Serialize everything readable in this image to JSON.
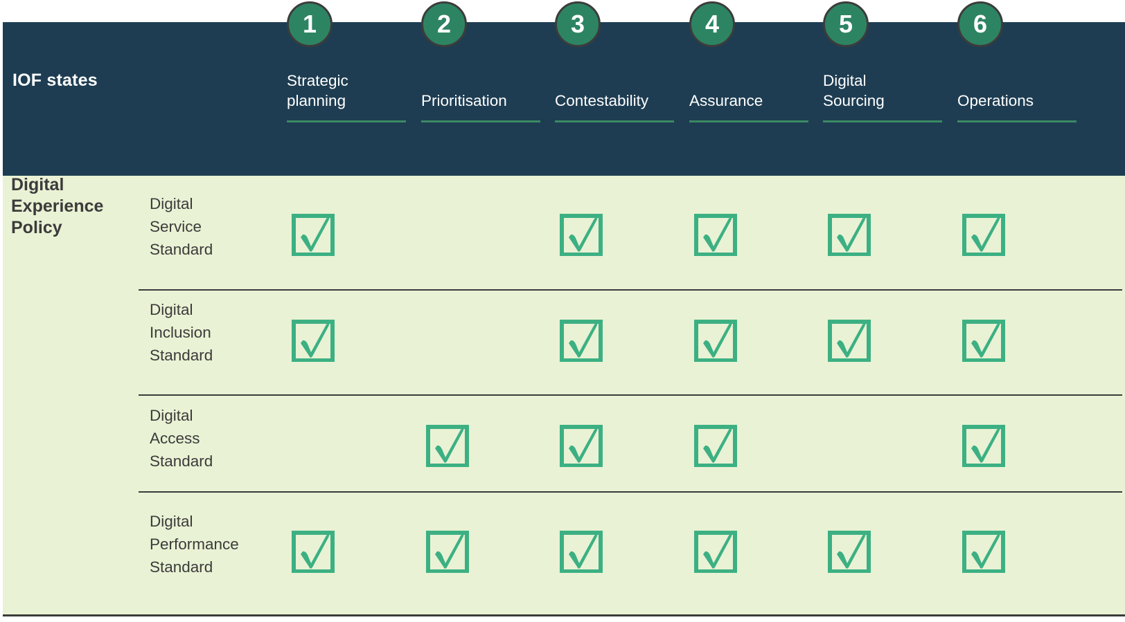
{
  "header": {
    "title": "IOF states",
    "background": "#1e3d52",
    "columns": [
      {
        "number": "1",
        "label": "Strategic\nplanning"
      },
      {
        "number": "2",
        "label": "Prioritisation"
      },
      {
        "number": "3",
        "label": "Contestability"
      },
      {
        "number": "4",
        "label": "Assurance"
      },
      {
        "number": "5",
        "label": "Digital\nSourcing"
      },
      {
        "number": "6",
        "label": "Operations"
      }
    ]
  },
  "body": {
    "group_label": "Digital\nExperience\nPolicy",
    "background": "#e9f2d4",
    "rows": [
      {
        "label": "Digital\nService\nStandard",
        "checks": [
          true,
          false,
          true,
          true,
          true,
          true
        ]
      },
      {
        "label": "Digital\nInclusion\nStandard",
        "checks": [
          true,
          false,
          true,
          true,
          true,
          true
        ]
      },
      {
        "label": "Digital\nAccess\nStandard",
        "checks": [
          false,
          true,
          true,
          true,
          false,
          true
        ]
      },
      {
        "label": "Digital\nPerformance\nStandard",
        "checks": [
          true,
          true,
          true,
          true,
          true,
          true
        ]
      }
    ]
  },
  "colors": {
    "navy": "#1e3d52",
    "pale_green": "#e9f2d4",
    "circle_green": "#2d8463",
    "circle_border": "#3c3c3c",
    "underline_green": "#3b8a63",
    "check_green": "#3cb083",
    "text_dark": "#3b3b3b",
    "text_light": "#ffffff"
  },
  "icons": {
    "check": "checkbox-checked-icon"
  }
}
